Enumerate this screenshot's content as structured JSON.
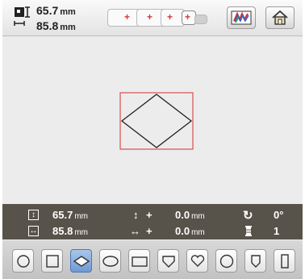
{
  "size": {
    "width": "65.7",
    "height": "85.8",
    "unit": "mm"
  },
  "status": {
    "height": "65.7",
    "width": "85.8",
    "unit": "mm",
    "offset_v": "0.0",
    "offset_h": "0.0",
    "rotation": "0°",
    "count": "1",
    "plus_v": "+",
    "plus_h": "+"
  },
  "colors": {
    "accent": "#d62e2e",
    "status_bg": "#58534a",
    "selected": "#7aa3d9"
  },
  "shapes": [
    "circle",
    "square",
    "diamond",
    "oval",
    "rectangle",
    "shield",
    "heart",
    "round",
    "badge",
    "tall-rectangle"
  ],
  "selected_shape": "diamond"
}
